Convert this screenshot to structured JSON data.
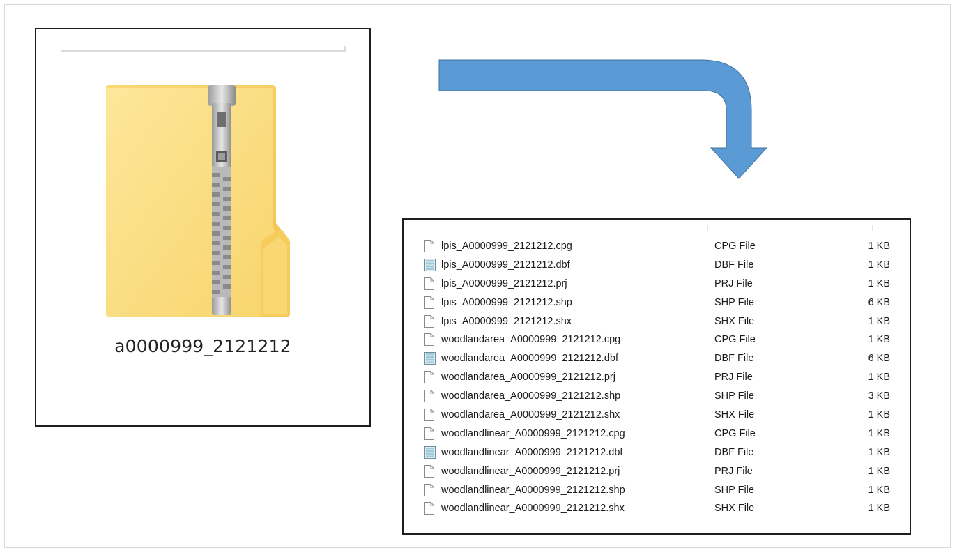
{
  "zip_archive": {
    "name": "a0000999_2121212",
    "icon": "zipped-folder-icon"
  },
  "arrow": {
    "icon": "curved-arrow-icon",
    "color": "#5b9bd5"
  },
  "files": [
    {
      "name": "lpis_A0000999_2121212.cpg",
      "type": "CPG File",
      "size": "1 KB",
      "icon": "document-icon"
    },
    {
      "name": "lpis_A0000999_2121212.dbf",
      "type": "DBF File",
      "size": "1 KB",
      "icon": "database-file-icon"
    },
    {
      "name": "lpis_A0000999_2121212.prj",
      "type": "PRJ File",
      "size": "1 KB",
      "icon": "document-icon"
    },
    {
      "name": "lpis_A0000999_2121212.shp",
      "type": "SHP File",
      "size": "6 KB",
      "icon": "document-icon"
    },
    {
      "name": "lpis_A0000999_2121212.shx",
      "type": "SHX File",
      "size": "1 KB",
      "icon": "document-icon"
    },
    {
      "name": "woodlandarea_A0000999_2121212.cpg",
      "type": "CPG File",
      "size": "1 KB",
      "icon": "document-icon"
    },
    {
      "name": "woodlandarea_A0000999_2121212.dbf",
      "type": "DBF File",
      "size": "6 KB",
      "icon": "database-file-icon"
    },
    {
      "name": "woodlandarea_A0000999_2121212.prj",
      "type": "PRJ File",
      "size": "1 KB",
      "icon": "document-icon"
    },
    {
      "name": "woodlandarea_A0000999_2121212.shp",
      "type": "SHP File",
      "size": "3 KB",
      "icon": "document-icon"
    },
    {
      "name": "woodlandarea_A0000999_2121212.shx",
      "type": "SHX File",
      "size": "1 KB",
      "icon": "document-icon"
    },
    {
      "name": "woodlandlinear_A0000999_2121212.cpg",
      "type": "CPG File",
      "size": "1 KB",
      "icon": "document-icon"
    },
    {
      "name": "woodlandlinear_A0000999_2121212.dbf",
      "type": "DBF File",
      "size": "1 KB",
      "icon": "database-file-icon"
    },
    {
      "name": "woodlandlinear_A0000999_2121212.prj",
      "type": "PRJ File",
      "size": "1 KB",
      "icon": "document-icon"
    },
    {
      "name": "woodlandlinear_A0000999_2121212.shp",
      "type": "SHP File",
      "size": "1 KB",
      "icon": "document-icon"
    },
    {
      "name": "woodlandlinear_A0000999_2121212.shx",
      "type": "SHX File",
      "size": "1 KB",
      "icon": "document-icon"
    }
  ]
}
